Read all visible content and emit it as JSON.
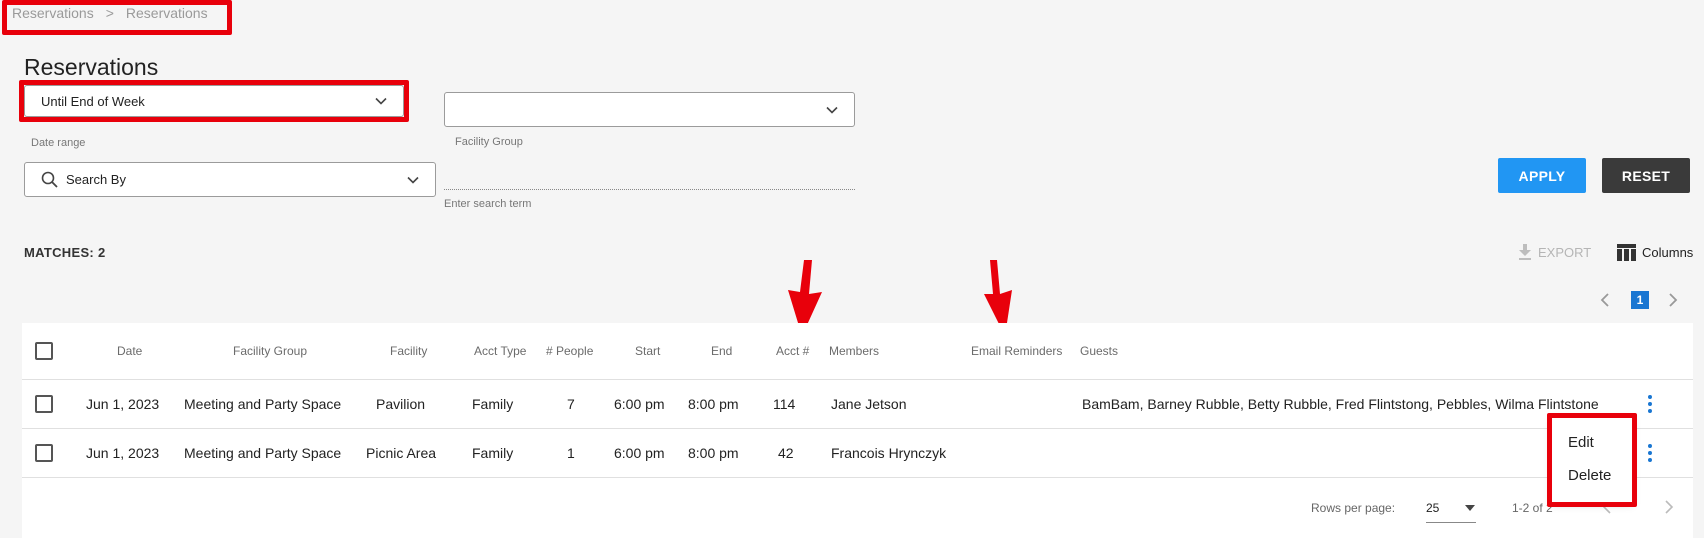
{
  "breadcrumb": {
    "items": [
      "Reservations",
      "Reservations"
    ],
    "separator": ">"
  },
  "page": {
    "title": "Reservations"
  },
  "filters": {
    "date_range": {
      "value": "Until End of Week",
      "label": "Date range"
    },
    "facility_group": {
      "value": "",
      "label": "Facility Group"
    },
    "search_by": {
      "value": "Search By"
    },
    "search_term": {
      "placeholder": "Enter search term"
    }
  },
  "actions": {
    "apply": "APPLY",
    "reset": "RESET"
  },
  "matches": "MATCHES: 2",
  "toolbar": {
    "export": "EXPORT",
    "columns": "Columns"
  },
  "pager": {
    "current": "1"
  },
  "table": {
    "headers": [
      "Date",
      "Facility Group",
      "Facility",
      "Acct Type",
      "# People",
      "Start",
      "End",
      "Acct #",
      "Members",
      "Email Reminders",
      "Guests"
    ],
    "rows": [
      [
        "Jun 1, 2023",
        "Meeting and Party Space",
        "Pavilion",
        "Family",
        "7",
        "6:00 pm",
        "8:00 pm",
        "114",
        "Jane Jetson",
        "",
        "BamBam, Barney Rubble, Betty Rubble, Fred Flintstong, Pebbles, Wilma Flintstone"
      ],
      [
        "Jun 1, 2023",
        "Meeting and Party Space",
        "Picnic Area",
        "Family",
        "1",
        "6:00 pm",
        "8:00 pm",
        "42",
        "Francois Hrynczyk",
        "",
        ""
      ]
    ]
  },
  "footer": {
    "rows_per_page_label": "Rows per page:",
    "rows_per_page_value": "25",
    "range": "1-2 of 2"
  },
  "context_menu": {
    "items": [
      "Edit",
      "Delete"
    ]
  },
  "colors": {
    "accent": "#2196f3",
    "page_badge": "#1976d2",
    "annotation": "#e8000b",
    "reset": "#3a3a3a"
  }
}
